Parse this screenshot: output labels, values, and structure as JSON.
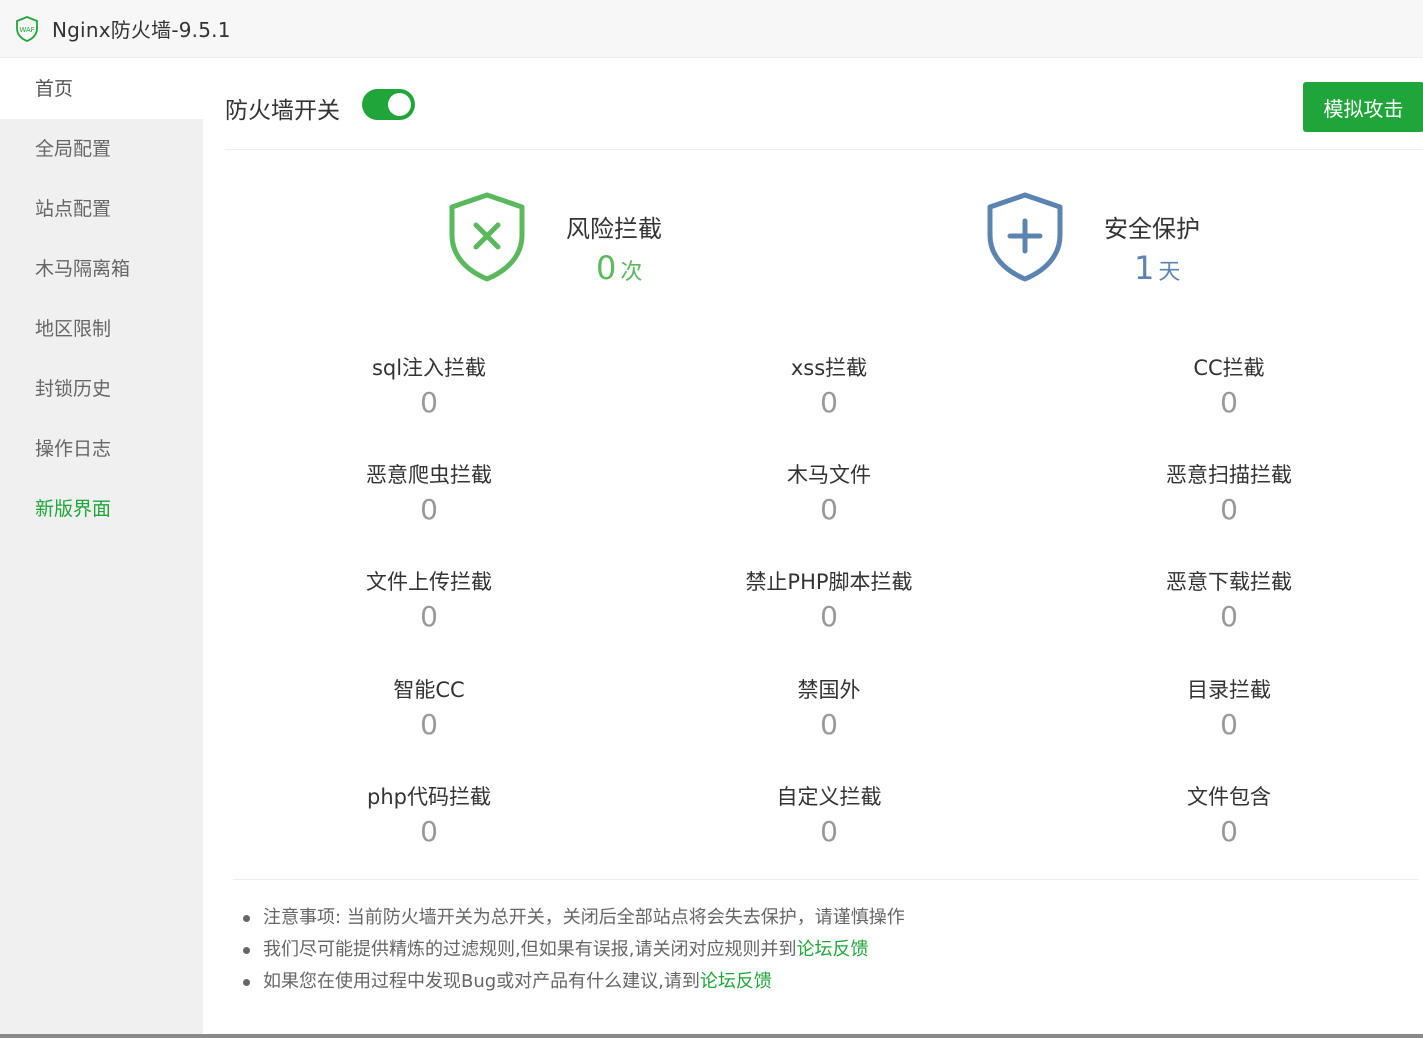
{
  "window": {
    "title": "Nginx防火墙-9.5.1",
    "logo_text": "WAF"
  },
  "sidebar": {
    "items": [
      {
        "label": "首页"
      },
      {
        "label": "全局配置"
      },
      {
        "label": "站点配置"
      },
      {
        "label": "木马隔离箱"
      },
      {
        "label": "地区限制"
      },
      {
        "label": "封锁历史"
      },
      {
        "label": "操作日志"
      },
      {
        "label": "新版界面"
      }
    ]
  },
  "header": {
    "switch_label": "防火墙开关",
    "switch_on": true,
    "attack_button": "模拟攻击"
  },
  "summary": {
    "risk": {
      "label": "风险拦截",
      "value": "0",
      "unit": "次"
    },
    "safe": {
      "label": "安全保护",
      "value": "1",
      "unit": "天"
    }
  },
  "counters": [
    {
      "label": "sql注入拦截",
      "value": "0"
    },
    {
      "label": "xss拦截",
      "value": "0"
    },
    {
      "label": "CC拦截",
      "value": "0"
    },
    {
      "label": "恶意爬虫拦截",
      "value": "0"
    },
    {
      "label": "木马文件",
      "value": "0"
    },
    {
      "label": "恶意扫描拦截",
      "value": "0"
    },
    {
      "label": "文件上传拦截",
      "value": "0"
    },
    {
      "label": "禁止PHP脚本拦截",
      "value": "0"
    },
    {
      "label": "恶意下载拦截",
      "value": "0"
    },
    {
      "label": "智能CC",
      "value": "0"
    },
    {
      "label": "禁国外",
      "value": "0"
    },
    {
      "label": "目录拦截",
      "value": "0"
    },
    {
      "label": "php代码拦截",
      "value": "0"
    },
    {
      "label": "自定义拦截",
      "value": "0"
    },
    {
      "label": "文件包含",
      "value": "0"
    }
  ],
  "notes": [
    {
      "text": "注意事项: 当前防火墙开关为总开关，关闭后全部站点将会失去保护，请谨慎操作",
      "link": ""
    },
    {
      "text": "我们尽可能提供精炼的过滤规则,但如果有误报,请关闭对应规则并到",
      "link": "论坛反馈"
    },
    {
      "text": "如果您在使用过程中发现Bug或对产品有什么建议,请到",
      "link": "论坛反馈"
    }
  ],
  "colors": {
    "accent": "#20a53a",
    "risk_shield": "#5cb85c",
    "safe_shield": "#5b84b1"
  }
}
